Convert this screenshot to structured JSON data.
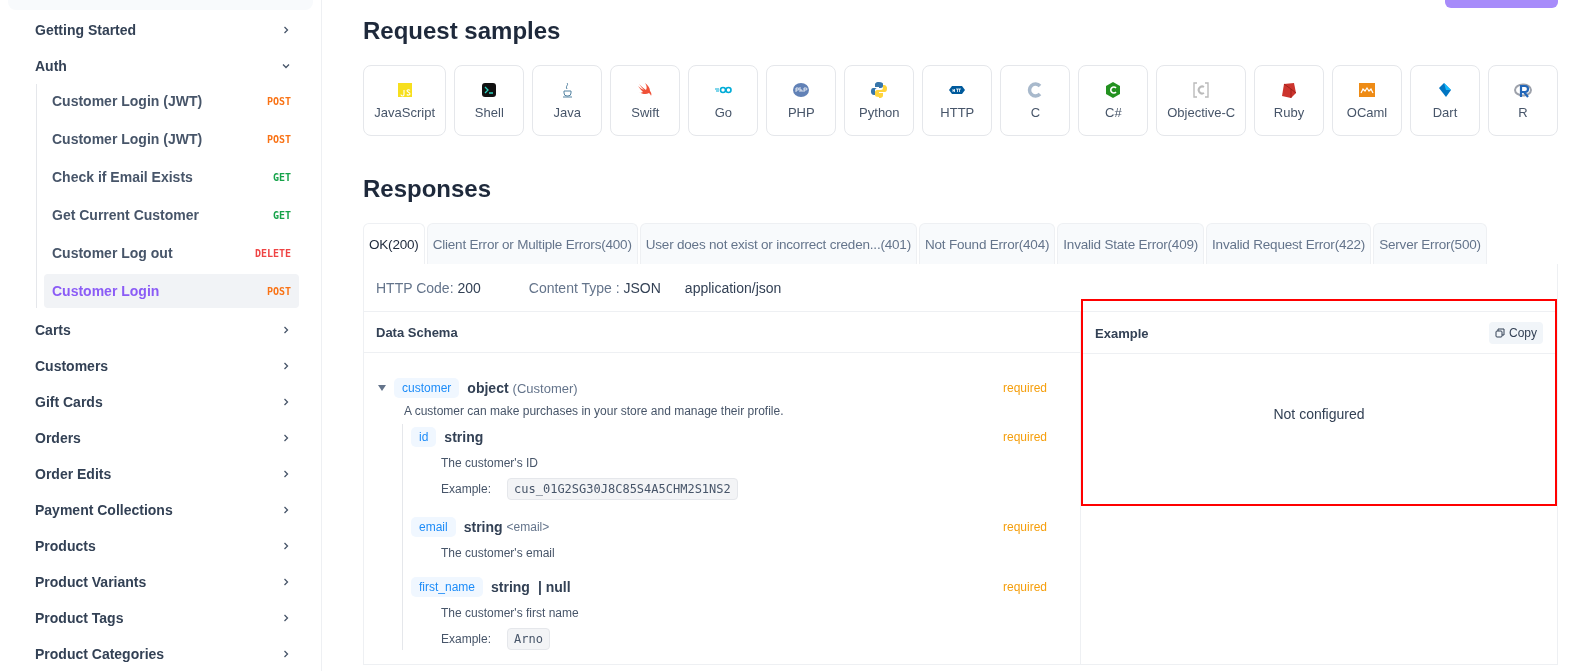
{
  "sidebar": {
    "items": [
      {
        "label": "Getting Started",
        "expanded": false
      },
      {
        "label": "Auth",
        "expanded": true,
        "children": [
          {
            "label": "Customer Login (JWT)",
            "method": "POST",
            "selected": false
          },
          {
            "label": "Customer Login (JWT)",
            "method": "POST",
            "selected": false
          },
          {
            "label": "Check if Email Exists",
            "method": "GET",
            "selected": false
          },
          {
            "label": "Get Current Customer",
            "method": "GET",
            "selected": false
          },
          {
            "label": "Customer Log out",
            "method": "DELETE",
            "selected": false
          },
          {
            "label": "Customer Login",
            "method": "POST",
            "selected": true
          }
        ]
      },
      {
        "label": "Carts",
        "expanded": false
      },
      {
        "label": "Customers",
        "expanded": false
      },
      {
        "label": "Gift Cards",
        "expanded": false
      },
      {
        "label": "Orders",
        "expanded": false
      },
      {
        "label": "Order Edits",
        "expanded": false
      },
      {
        "label": "Payment Collections",
        "expanded": false
      },
      {
        "label": "Products",
        "expanded": false
      },
      {
        "label": "Product Variants",
        "expanded": false
      },
      {
        "label": "Product Tags",
        "expanded": false
      },
      {
        "label": "Product Categories",
        "expanded": false
      }
    ]
  },
  "request_samples": {
    "title": "Request samples",
    "languages": [
      {
        "label": "JavaScript"
      },
      {
        "label": "Shell"
      },
      {
        "label": "Java"
      },
      {
        "label": "Swift"
      },
      {
        "label": "Go"
      },
      {
        "label": "PHP"
      },
      {
        "label": "Python"
      },
      {
        "label": "HTTP"
      },
      {
        "label": "C"
      },
      {
        "label": "C#"
      },
      {
        "label": "Objective-C"
      },
      {
        "label": "Ruby"
      },
      {
        "label": "OCaml"
      },
      {
        "label": "Dart"
      },
      {
        "label": "R"
      }
    ]
  },
  "responses": {
    "title": "Responses",
    "tabs": [
      {
        "label": "OK(200)",
        "selected": true
      },
      {
        "label": "Client Error or Multiple Errors(400)",
        "selected": false
      },
      {
        "label": "User does not exist or incorrect creden...(401)",
        "selected": false
      },
      {
        "label": "Not Found Error(404)",
        "selected": false
      },
      {
        "label": "Invalid State Error(409)",
        "selected": false
      },
      {
        "label": "Invalid Request Error(422)",
        "selected": false
      },
      {
        "label": "Server Error(500)",
        "selected": false
      }
    ],
    "http_code_label": "HTTP Code:",
    "http_code": "200",
    "content_type_label": "Content Type :",
    "content_type": "JSON",
    "mime": "application/json",
    "schema_title": "Data Schema",
    "schema": [
      {
        "name": "customer",
        "type": "object",
        "type_note": "(Customer)",
        "required_label": "required",
        "expanded": true,
        "description": "A customer can make purchases in your store and manage their profile.",
        "children": [
          {
            "name": "id",
            "type": "string",
            "required_label": "required",
            "description": "The customer's ID",
            "example_label": "Example:",
            "example": "cus_01G2SG30J8C85S4A5CHM2S1NS2"
          },
          {
            "name": "email",
            "type": "string",
            "format": "<email>",
            "required_label": "required",
            "description": "The customer's email"
          },
          {
            "name": "first_name",
            "type": "string",
            "union": "| null",
            "required_label": "required",
            "description": "The customer's first name",
            "example_label": "Example:",
            "example": "Arno"
          }
        ]
      }
    ],
    "example": {
      "title": "Example",
      "copy_label": "Copy",
      "body": "Not configured",
      "highlighted": true
    }
  }
}
